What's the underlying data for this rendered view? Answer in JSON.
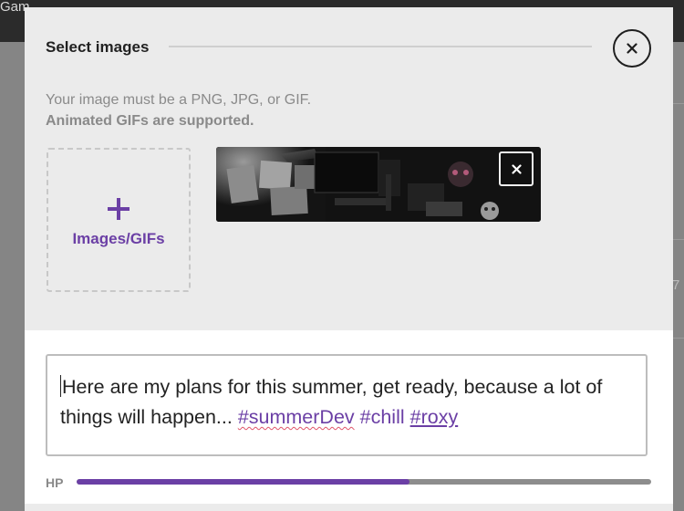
{
  "background": {
    "topbar_text": "Gam"
  },
  "modal": {
    "title": "Select images",
    "hint_line1": "Your image must be a PNG, JPG, or GIF.",
    "hint_line2": "Animated GIFs are supported.",
    "upload_label": "Images/GIFs",
    "caption": {
      "text": "Here are my plans for this summer, get ready, because a lot of things will happen... ",
      "hashtags": [
        "#summerDev",
        "#chill",
        "#roxy"
      ]
    },
    "hp": {
      "label": "HP",
      "value_fraction": 0.58
    }
  },
  "colors": {
    "accent": "#6b3fa5",
    "modal_bg": "#ebebeb",
    "overlay": "#858585",
    "spell_underline": "#e0566a"
  },
  "icons": {
    "close": "close-icon",
    "upload_plus": "plus-icon",
    "remove_image": "remove-image-icon"
  }
}
